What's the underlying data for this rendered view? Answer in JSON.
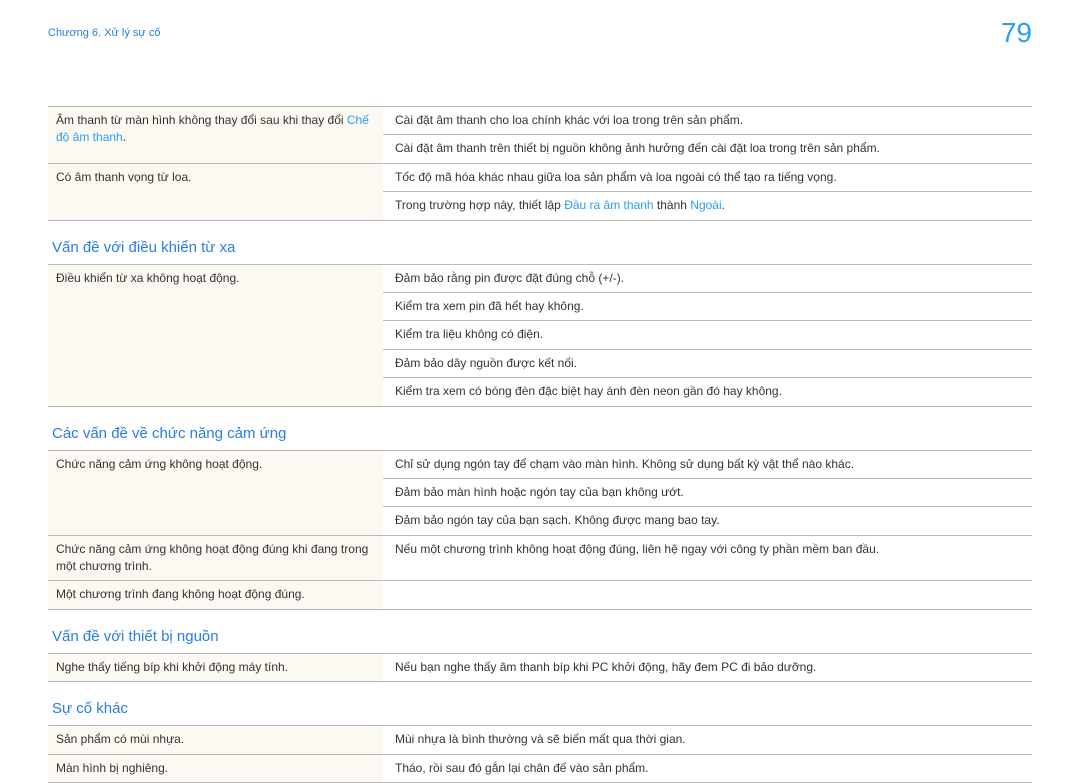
{
  "header": {
    "chapter": "Chương 6. Xử lý sự cố",
    "page_number": "79"
  },
  "sections": [
    {
      "key": "sound_continued",
      "heading": null,
      "rows": [
        {
          "left_parts": [
            {
              "text": "Âm thanh từ màn hình không thay đổi sau khi thay đổi "
            },
            {
              "text": "Chế độ âm thanh",
              "blue": true
            },
            {
              "text": "."
            }
          ],
          "rights": [
            "Cài đặt âm thanh cho loa chính khác với loa trong trên sản phẩm.",
            "Cài đặt âm thanh trên thiết bị nguồn không ảnh hưởng đến cài đặt loa trong trên sản phẩm."
          ]
        },
        {
          "left_parts": [
            {
              "text": "Có âm thanh vọng từ loa."
            }
          ],
          "rights": [
            "Tốc độ mã hóa khác nhau giữa loa sản phẩm và loa ngoài có thể tạo ra tiếng vọng."
          ],
          "extra_right_parts": [
            {
              "text": "Trong trường hợp này, thiết lập "
            },
            {
              "text": "Đầu ra âm thanh",
              "blue": true
            },
            {
              "text": " thành "
            },
            {
              "text": "Ngoài",
              "blue": true
            },
            {
              "text": "."
            }
          ]
        }
      ]
    },
    {
      "key": "remote",
      "heading": "Vấn đề với điều khiển từ xa",
      "rows": [
        {
          "left_parts": [
            {
              "text": "Điều khiển từ xa không hoạt động."
            }
          ],
          "rights": [
            "Đảm bảo rằng pin được đặt đúng chỗ (+/-).",
            "Kiểm tra xem pin đã hết hay không.",
            "Kiểm tra liệu không có điện.",
            "Đảm bảo dây nguồn được kết nối.",
            "Kiểm tra xem có bóng đèn đặc biệt hay ánh đèn neon gần đó hay không."
          ]
        }
      ]
    },
    {
      "key": "touch",
      "heading": "Các vấn đề về chức năng cảm ứng",
      "rows": [
        {
          "left_parts": [
            {
              "text": "Chức năng cảm ứng không hoạt động."
            }
          ],
          "rights": [
            "Chỉ sử dụng ngón tay để chạm vào màn hình. Không sử dụng bất kỳ vật thể nào khác.",
            "Đảm bảo màn hình hoặc ngón tay của bạn không ướt.",
            "Đảm bảo ngón tay của bạn sạch. Không được mang bao tay."
          ]
        },
        {
          "left_parts": [
            {
              "text": "Chức năng cảm ứng không hoạt động đúng khi đang trong một chương trình."
            }
          ],
          "rights": [
            "Nếu một chương trình không hoạt động đúng, liên hệ ngay với công ty phần mềm ban đầu."
          ]
        },
        {
          "left_parts": [
            {
              "text": "Một chương trình đang không hoạt động đúng."
            }
          ],
          "rights": [
            ""
          ]
        }
      ]
    },
    {
      "key": "source_device",
      "heading": "Vấn đề với thiết bị nguồn",
      "rows": [
        {
          "left_parts": [
            {
              "text": "Nghe thấy tiếng bíp khi khởi động máy tính."
            }
          ],
          "rights": [
            "Nếu bạn nghe thấy âm thanh bíp khi PC khởi động, hãy đem PC đi bảo dưỡng."
          ]
        }
      ]
    },
    {
      "key": "other",
      "heading": "Sự cố khác",
      "rows": [
        {
          "left_parts": [
            {
              "text": "Sản phẩm có mùi nhựa."
            }
          ],
          "rights": [
            "Mùi nhựa là bình thường và sẽ biến mất qua thời gian."
          ]
        },
        {
          "left_parts": [
            {
              "text": "Màn hình bị nghiêng."
            }
          ],
          "rights": [
            "Tháo, rồi sau đó gắn lại chân đế vào sản phẩm."
          ]
        }
      ]
    }
  ]
}
